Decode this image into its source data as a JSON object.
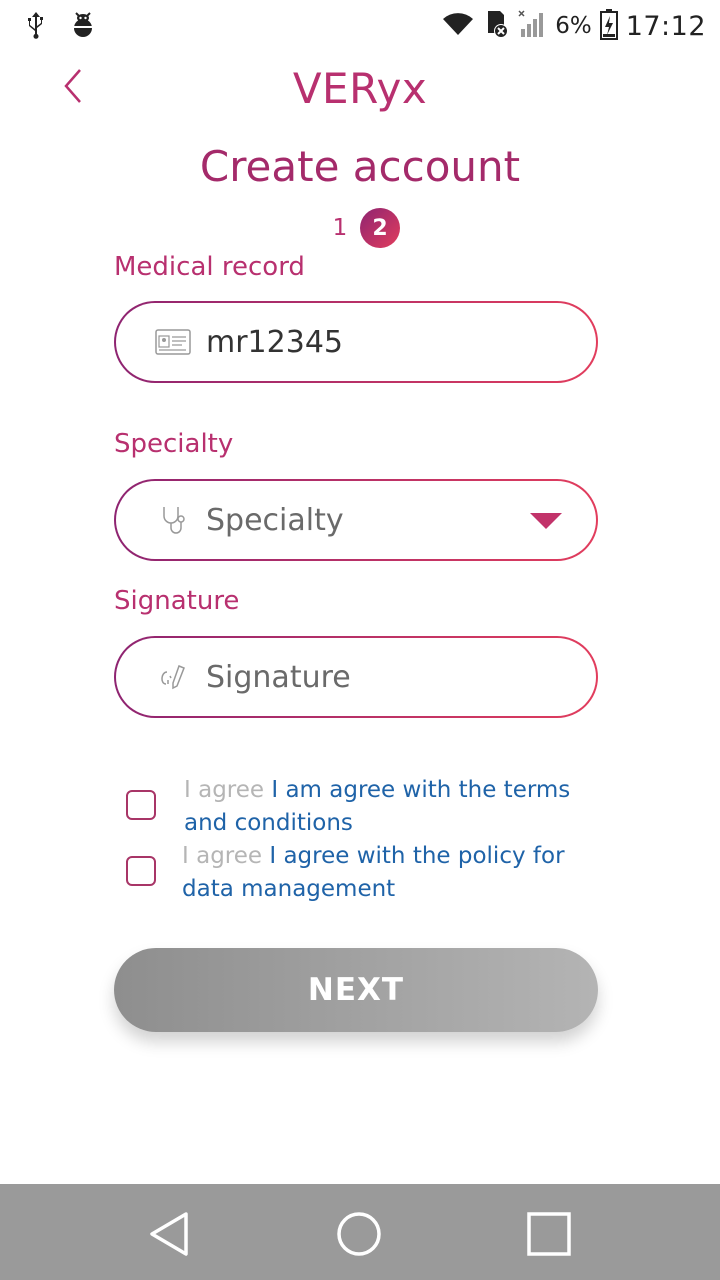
{
  "status_bar": {
    "battery_percent": "6%",
    "time": "17:12",
    "icons": [
      "usb-icon",
      "bug-icon",
      "wifi-icon",
      "sd-card-icon",
      "signal-icon",
      "battery-icon"
    ]
  },
  "header": {
    "back_icon": "chevron-left-icon",
    "app_title": "VERyx",
    "page_title": "Create account"
  },
  "stepper": {
    "step_1": "1",
    "step_2": "2",
    "current": 2
  },
  "form": {
    "medical_record": {
      "label": "Medical record",
      "value": "mr12345",
      "icon": "id-card-icon"
    },
    "specialty": {
      "label": "Specialty",
      "placeholder": "Specialty",
      "icon": "stethoscope-icon"
    },
    "signature": {
      "label": "Signature",
      "placeholder": "Signature",
      "icon": "signature-pen-icon"
    }
  },
  "agreements": [
    {
      "prefix": "I agree",
      "text": "I am agree with the terms and conditions",
      "checked": false
    },
    {
      "prefix": "I agree",
      "text": "I agree with the policy for data management",
      "checked": false
    }
  ],
  "next_button": {
    "label": "NEXT"
  },
  "nav_bar": {
    "icons": [
      "nav-back-icon",
      "nav-home-icon",
      "nav-recents-icon"
    ]
  },
  "colors": {
    "brand_start": "#8e2471",
    "brand_end": "#e23d5d",
    "link": "#1f63a8",
    "button_disabled": "#9e9e9e",
    "nav_bar": "#9a9a9a"
  }
}
